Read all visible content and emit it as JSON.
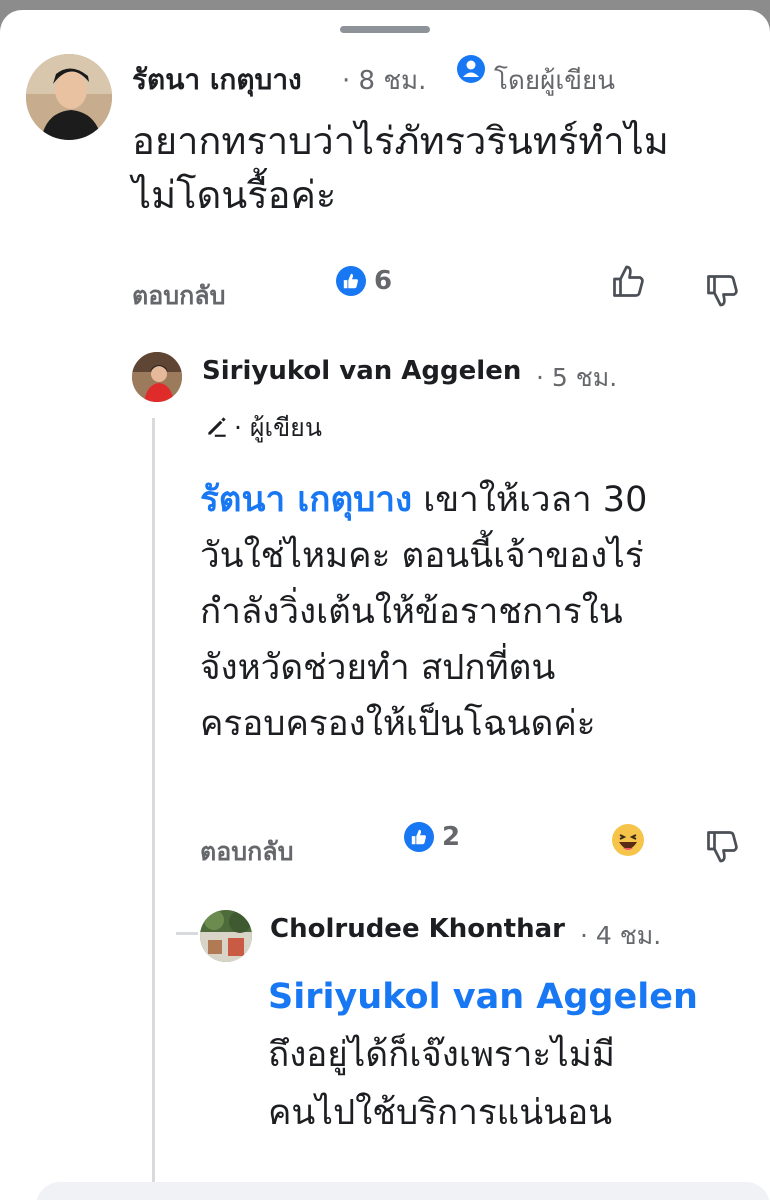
{
  "comment1": {
    "author": "รัตนา เกตุบาง",
    "time": "· 8 ชม.",
    "author_badge": "โดยผู้เขียน",
    "text_line1": "อยากทราบว่าไร่ภัทรวรินทร์ทำไม",
    "text_line2": "ไม่โดนรื้อค่ะ",
    "reply_label": "ตอบกลับ",
    "like_count": "6"
  },
  "comment2": {
    "author": "Siriyukol van Aggelen",
    "time": "· 5 ชม.",
    "author_badge": "· ผู้เขียน",
    "mention": "รัตนา เกตุบาง",
    "text_line1_rest": " เขาให้เวลา 30",
    "text_line2": "วันใช่ไหมคะ ตอนนี้เจ้าของไร่",
    "text_line3": "กำลังวิ่งเต้นให้ข้อราชการใน",
    "text_line4": "จังหวัดช่วยทำ สปกที่ตน",
    "text_line5": "ครอบครองให้เป็นโฉนดค่ะ",
    "reply_label": "ตอบกลับ",
    "like_count": "2"
  },
  "comment3": {
    "author": "Cholrudee Khonthar",
    "time": "· 4 ชม.",
    "mention": "Siriyukol van Aggelen",
    "text_line1": "ถึงอยู่ได้ก็เจ๊งเพราะไม่มี",
    "text_line2": "คนไปใช้บริการแน่นอน"
  },
  "icons": [
    "author-badge-icon",
    "like-badge-icon",
    "thumbs-up-icon",
    "thumbs-down-icon",
    "pencil-icon",
    "haha-reaction-icon"
  ],
  "colors": {
    "accent": "#1877f2",
    "secondary_text": "#65676b",
    "background": "#ffffff"
  }
}
